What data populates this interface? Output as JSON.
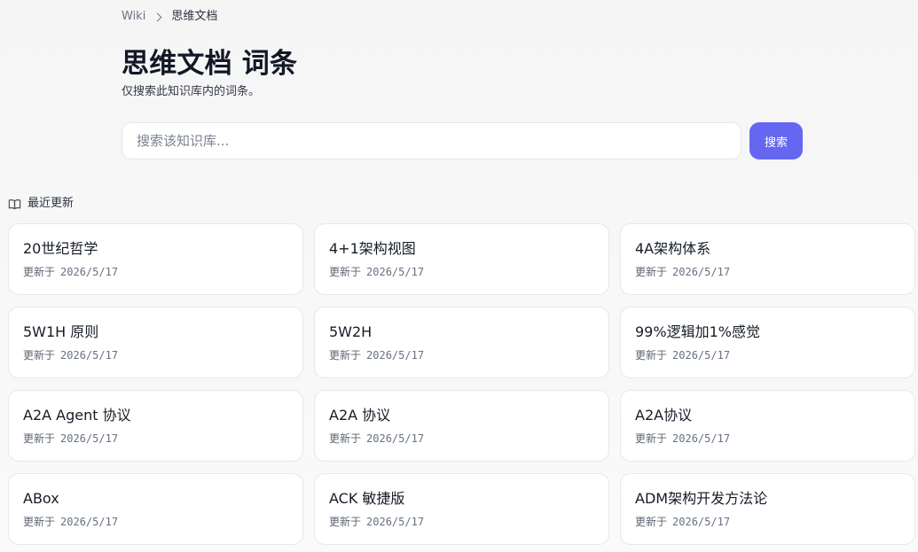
{
  "breadcrumb": {
    "root": "Wiki",
    "current": "思维文档"
  },
  "header": {
    "title": "思维文档 词条",
    "subtitle": "仅搜索此知识库内的词条。"
  },
  "search": {
    "placeholder": "搜索该知识库...",
    "value": "",
    "button_label": "搜索"
  },
  "recent": {
    "label": "最近更新",
    "icon": "book-open-icon",
    "updated_prefix": "更新于",
    "cards": [
      {
        "title": "20世纪哲学",
        "date": "2026/5/17"
      },
      {
        "title": "4+1架构视图",
        "date": "2026/5/17"
      },
      {
        "title": "4A架构体系",
        "date": "2026/5/17"
      },
      {
        "title": "5W1H 原则",
        "date": "2026/5/17"
      },
      {
        "title": "5W2H",
        "date": "2026/5/17"
      },
      {
        "title": "99%逻辑加1%感觉",
        "date": "2026/5/17"
      },
      {
        "title": "A2A Agent 协议",
        "date": "2026/5/17"
      },
      {
        "title": "A2A 协议",
        "date": "2026/5/17"
      },
      {
        "title": "A2A协议",
        "date": "2026/5/17"
      },
      {
        "title": "ABox",
        "date": "2026/5/17"
      },
      {
        "title": "ACK 敏捷版",
        "date": "2026/5/17"
      },
      {
        "title": "ADM架构开发方法论",
        "date": "2026/5/17"
      }
    ]
  },
  "colors": {
    "accent": "#6667f0",
    "background": "#f7f7f7",
    "card": "#ffffff",
    "border": "#e7e8ec"
  }
}
